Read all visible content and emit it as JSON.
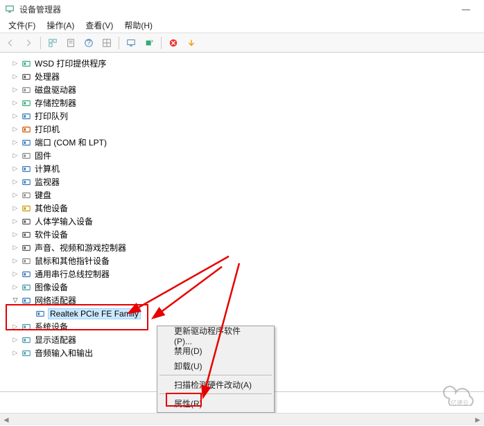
{
  "title_bar": {
    "title": "设备管理器",
    "min": "—"
  },
  "menu": {
    "file": "文件(F)",
    "action": "操作(A)",
    "view": "查看(V)",
    "help": "帮助(H)"
  },
  "tree": {
    "items": [
      {
        "label": "WSD 打印提供程序"
      },
      {
        "label": "处理器"
      },
      {
        "label": "磁盘驱动器"
      },
      {
        "label": "存储控制器"
      },
      {
        "label": "打印队列"
      },
      {
        "label": "打印机"
      },
      {
        "label": "端口 (COM 和 LPT)"
      },
      {
        "label": "固件"
      },
      {
        "label": "计算机"
      },
      {
        "label": "监视器"
      },
      {
        "label": "键盘"
      },
      {
        "label": "其他设备"
      },
      {
        "label": "人体学输入设备"
      },
      {
        "label": "软件设备"
      },
      {
        "label": "声音、视频和游戏控制器"
      },
      {
        "label": "鼠标和其他指针设备"
      },
      {
        "label": "通用串行总线控制器"
      },
      {
        "label": "图像设备"
      }
    ],
    "network": {
      "label": "网络适配器",
      "child": "Realtek PCIe FE Family"
    },
    "after": [
      {
        "label": "系统设备"
      },
      {
        "label": "显示适配器"
      },
      {
        "label": "音频输入和输出"
      }
    ]
  },
  "context_menu": {
    "update": "更新驱动程序软件(P)...",
    "disable": "禁用(D)",
    "uninstall": "卸载(U)",
    "scan": "扫描检测硬件改动(A)",
    "properties": "属性(R)"
  },
  "watermark": "亿速云"
}
